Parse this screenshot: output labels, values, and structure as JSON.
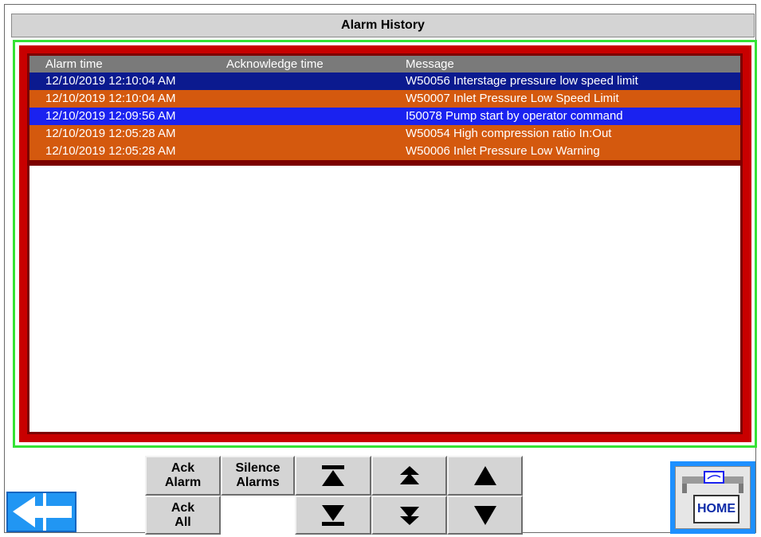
{
  "title": "Alarm History",
  "table": {
    "headers": {
      "alarm_time": "Alarm time",
      "acknowledge_time": "Acknowledge time",
      "message": "Message"
    },
    "rows": [
      {
        "alarm_time": "12/10/2019 12:10:04 AM",
        "acknowledge_time": "",
        "message": "W50056 Interstage pressure low speed limit",
        "color": "#0b1a8f"
      },
      {
        "alarm_time": "12/10/2019 12:10:04 AM",
        "acknowledge_time": "",
        "message": "W50007 Inlet Pressure Low Speed Limit",
        "color": "#d4590e"
      },
      {
        "alarm_time": "12/10/2019 12:09:56 AM",
        "acknowledge_time": "",
        "message": "I50078 Pump start by operator command",
        "color": "#1a22f0"
      },
      {
        "alarm_time": "12/10/2019 12:05:28 AM",
        "acknowledge_time": "",
        "message": "W50054 High compression ratio In:Out",
        "color": "#d4590e"
      },
      {
        "alarm_time": "12/10/2019 12:05:28 AM",
        "acknowledge_time": "",
        "message": "W50006 Inlet Pressure Low Warning",
        "color": "#d4590e"
      }
    ]
  },
  "buttons": {
    "ack_alarm": {
      "line1": "Ack",
      "line2": "Alarm"
    },
    "silence_alarms": {
      "line1": "Silence",
      "line2": "Alarms"
    },
    "ack_all": {
      "line1": "Ack",
      "line2": "All"
    },
    "home": "HOME"
  },
  "icons": {
    "first_page": "arrow-to-top-icon",
    "page_up": "double-up-icon",
    "line_up": "up-triangle-icon",
    "last_page": "arrow-to-bottom-icon",
    "page_down": "double-down-icon",
    "line_down": "down-triangle-icon",
    "back": "arrow-left-icon",
    "home": "home-logo-icon"
  },
  "colors": {
    "frame_green": "#34e234",
    "frame_red": "#c80000",
    "header_gray": "#7a7a7a",
    "blue_row_dark": "#0b1a8f",
    "blue_row_bright": "#1a22f0",
    "orange_row": "#d4590e",
    "nav_blue": "#1e90ff"
  }
}
